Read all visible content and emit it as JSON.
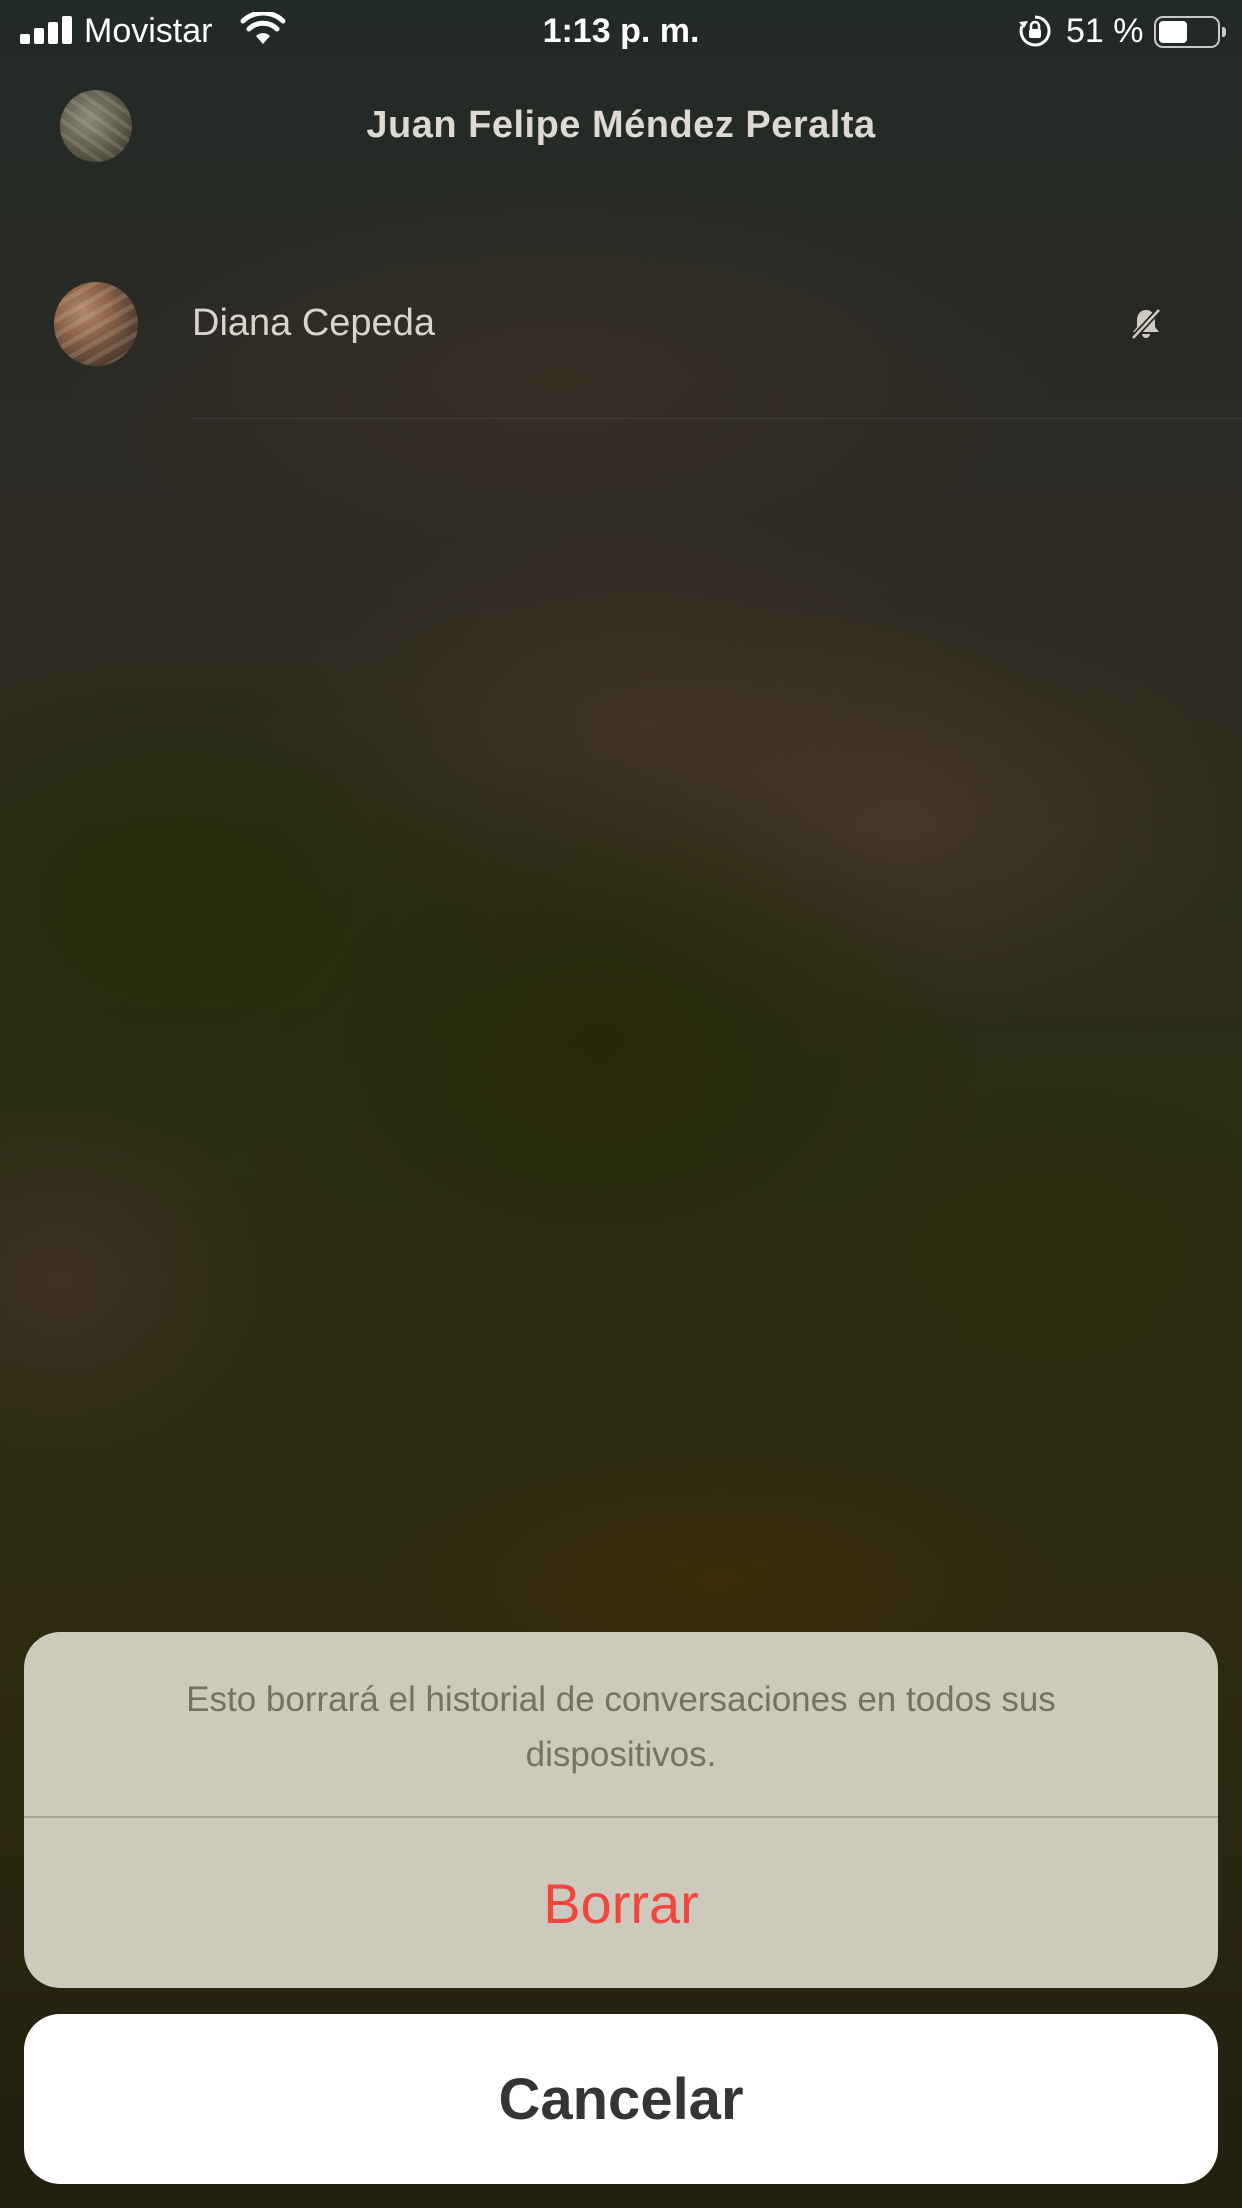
{
  "status_bar": {
    "carrier": "Movistar",
    "time": "1:13 p. m.",
    "battery_percent": "51 %",
    "battery_level": 0.51,
    "icons": [
      "signal-icon",
      "wifi-icon",
      "orientation-lock-icon",
      "battery-icon"
    ]
  },
  "header": {
    "title": "Juan Felipe Méndez Peralta"
  },
  "chat_list": {
    "items": [
      {
        "name": "Diana Cepeda",
        "muted": true,
        "mute_icon": "bell-slash-icon"
      }
    ]
  },
  "action_sheet": {
    "message": "Esto borrará el historial de conversaciones en todos sus dispositivos.",
    "destructive_label": "Borrar",
    "cancel_label": "Cancelar",
    "destructive_color": "#f2453d"
  }
}
